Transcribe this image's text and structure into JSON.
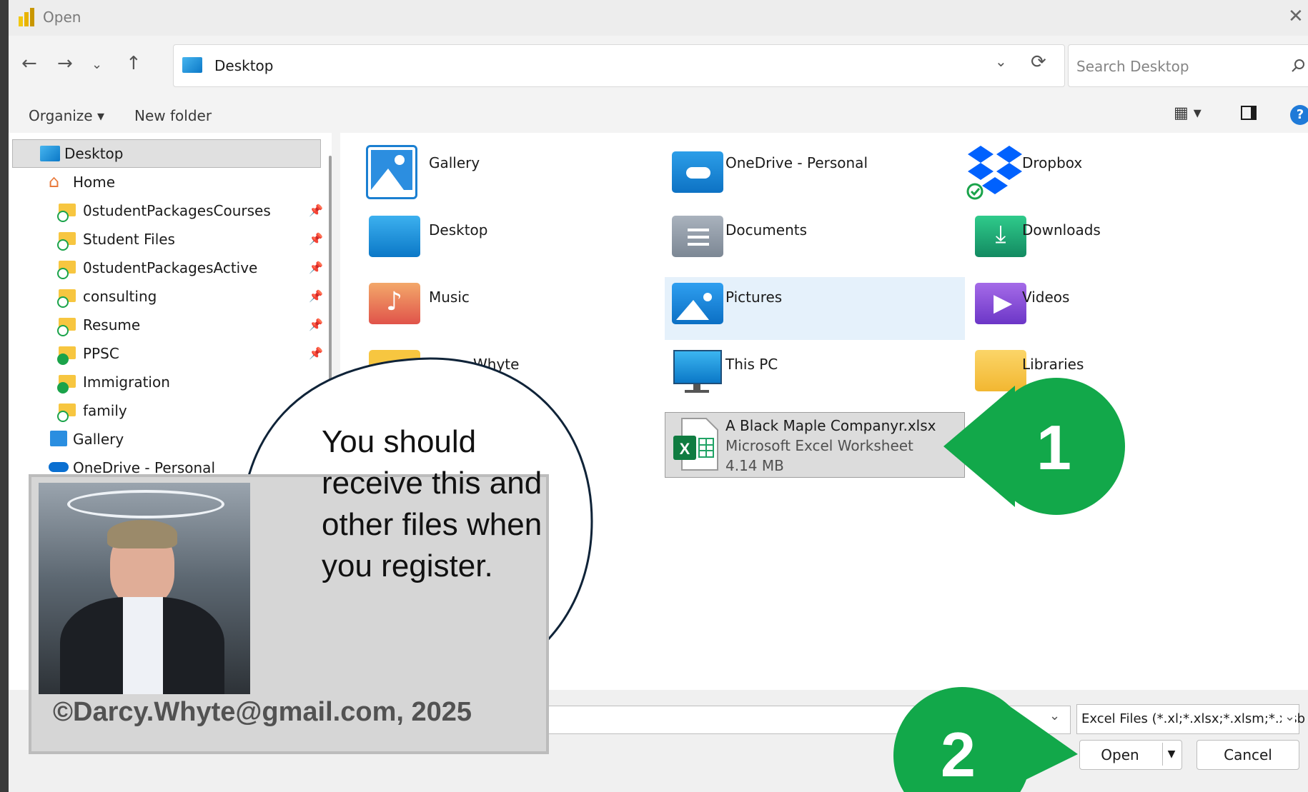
{
  "window": {
    "title": "Open",
    "close_glyph": "✕"
  },
  "address": {
    "path": "Desktop",
    "search_placeholder": "Search Desktop"
  },
  "toolbar": {
    "organize": "Organize",
    "new_folder": "New folder",
    "help": "?"
  },
  "nav": {
    "selected": "Desktop",
    "home": "Home",
    "pinned": [
      "0studentPackagesCourses",
      "Student Files",
      "0studentPackagesActive",
      "consulting",
      "Resume",
      "PPSC",
      "Immigration",
      "family"
    ],
    "gallery": "Gallery",
    "onedrive": "OneDrive - Personal"
  },
  "items": [
    {
      "label": "Gallery",
      "icon": "gallery-icon"
    },
    {
      "label": "OneDrive - Personal",
      "icon": "onedrive-folder-icon"
    },
    {
      "label": "Dropbox",
      "icon": "dropbox-icon"
    },
    {
      "label": "Desktop",
      "icon": "desktop-folder-icon"
    },
    {
      "label": "Documents",
      "icon": "documents-folder-icon"
    },
    {
      "label": "Downloads",
      "icon": "downloads-folder-icon"
    },
    {
      "label": "Music",
      "icon": "music-folder-icon"
    },
    {
      "label": "Pictures",
      "icon": "pictures-folder-icon"
    },
    {
      "label": "Videos",
      "icon": "videos-folder-icon"
    },
    {
      "label": "Whyte",
      "icon": "folder-icon"
    },
    {
      "label": "This PC",
      "icon": "monitor-icon"
    },
    {
      "label": "Libraries",
      "icon": "libraries-folder-icon"
    }
  ],
  "file": {
    "name": "A  Black Maple Companyr.xlsx",
    "type": "Microsoft Excel Worksheet",
    "size": "4.14 MB"
  },
  "footer": {
    "file_type": "Excel Files (*.xl;*.xlsx;*.xlsm;*.xlsb",
    "open": "Open",
    "cancel": "Cancel"
  },
  "overlay": {
    "bubble": "You should receive this and other files when you register.",
    "copyright": "©Darcy.Whyte@gmail.com, 2025",
    "step1": "1",
    "step2": "2",
    "accent_green": "#12a84a"
  }
}
